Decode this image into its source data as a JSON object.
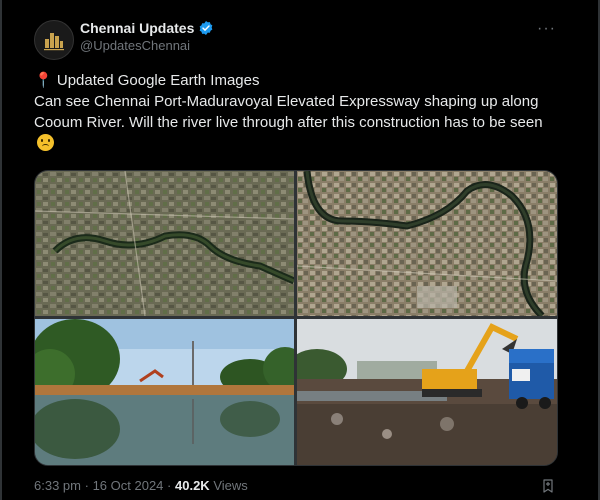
{
  "author": {
    "name": "Chennai Updates",
    "handle": "@UpdatesChennai",
    "avatar_text": "CHENNAI UPDATES"
  },
  "tweet": {
    "line1": "Updated Google Earth Images",
    "line2": "Can see Chennai Port-Maduravoyal Elevated Expressway shaping up along Cooum River. Will the river live through after this construction has to be seen"
  },
  "meta": {
    "time": "6:33 pm",
    "date": "16 Oct 2024",
    "views_count": "40.2K",
    "views_label": "Views",
    "sep": "·"
  },
  "icons": {
    "verified": "verified-badge-icon",
    "more": "more-icon",
    "pin": "pin-icon",
    "emoji": "frowning-face-emoji",
    "bookmark": "bookmark-icon"
  },
  "colors": {
    "background": "#000000",
    "text": "#e7e9ea",
    "secondary": "#71767b",
    "verified": "#1d9bf0"
  }
}
